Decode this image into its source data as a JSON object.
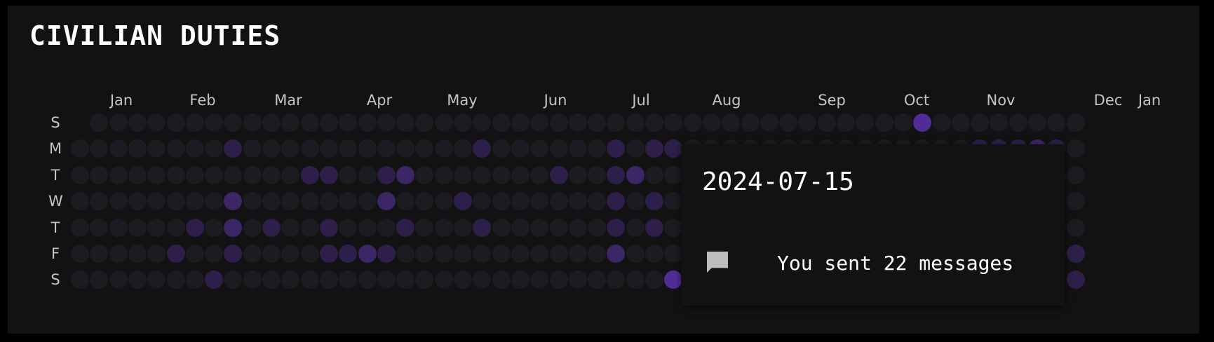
{
  "title": "CIVILIAN DUTIES",
  "months": [
    "Jan",
    "Feb",
    "Mar",
    "Apr",
    "May",
    "Jun",
    "Jul",
    "Aug",
    "Sep",
    "Oct",
    "Nov",
    "Dec",
    "Jan"
  ],
  "days": [
    "S",
    "M",
    "T",
    "W",
    "T",
    "F",
    "S"
  ],
  "colors": {
    "background": "#121212",
    "level0": "#1c1b21",
    "level1": "#2d1f49",
    "level2": "#3c2666",
    "level3": "#522c96",
    "level4": "#5d2fb0"
  },
  "activity_levels": {
    "5": {
      "5": 1
    },
    "6": {
      "4": 1
    },
    "7": {
      "6": 1
    },
    "8": {
      "1": 1,
      "3": 2,
      "4": 2,
      "5": 1
    },
    "10": {
      "4": 1
    },
    "12": {
      "2": 1
    },
    "13": {
      "2": 1,
      "4": 1,
      "5": 1
    },
    "14": {
      "5": 1
    },
    "15": {
      "5": 2
    },
    "16": {
      "2": 1,
      "3": 2,
      "5": 1
    },
    "17": {
      "2": 2,
      "4": 1
    },
    "20": {
      "3": 1
    },
    "21": {
      "1": 1,
      "4": 1
    },
    "25": {
      "2": 1
    },
    "28": {
      "1": 1,
      "2": 1,
      "3": 1,
      "4": 1,
      "5": 2
    },
    "29": {
      "2": 2
    },
    "30": {
      "1": 1,
      "3": 1,
      "4": 1
    },
    "31": {
      "1": 1,
      "6": 3
    },
    "44": {
      "0": 3
    },
    "47": {
      "1": 1,
      "5": 1
    },
    "48": {
      "1": 1
    },
    "49": {
      "1": 1,
      "2": 2,
      "5": 2
    },
    "50": {
      "1": 2
    },
    "51": {
      "1": 1,
      "2": 1
    },
    "52": {
      "5": 1,
      "6": 1
    }
  },
  "tooltip": {
    "date": "2024-07-15",
    "icon": "message-icon",
    "text": "You sent 22 messages"
  }
}
